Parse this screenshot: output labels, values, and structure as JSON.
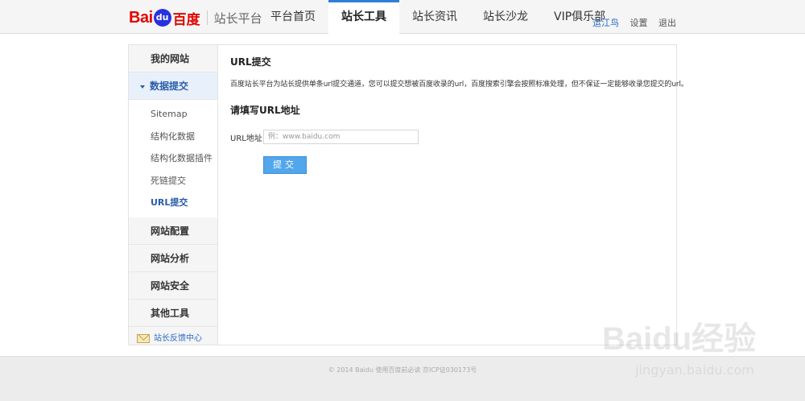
{
  "header": {
    "logo_text_bai": "Bai",
    "logo_text_du": "du",
    "logo_text_cn": "百度",
    "logo_subtitle": "站长平台",
    "nav": [
      {
        "label": "平台首页",
        "active": false
      },
      {
        "label": "站长工具",
        "active": true
      },
      {
        "label": "站长资讯",
        "active": false
      },
      {
        "label": "站长沙龙",
        "active": false
      },
      {
        "label": "VIP俱乐部",
        "active": false
      }
    ],
    "user": {
      "name": "运江鸟",
      "settings": "设置",
      "logout": "退出"
    }
  },
  "sidebar": {
    "my_site": "我的网站",
    "data_submit": "数据提交",
    "sub_items": [
      {
        "label": "Sitemap",
        "active": false
      },
      {
        "label": "结构化数据",
        "active": false
      },
      {
        "label": "结构化数据插件",
        "active": false
      },
      {
        "label": "死链提交",
        "active": false
      },
      {
        "label": "URL提交",
        "active": true
      }
    ],
    "site_config": "网站配置",
    "site_analysis": "网站分析",
    "site_security": "网站安全",
    "other_tools": "其他工具",
    "feedback": "站长反馈中心"
  },
  "main": {
    "title": "URL提交",
    "description": "百度站长平台为站长提供单条url提交通道，您可以提交想被百度收录的url，百度搜索引擎会按照标准处理，但不保证一定能够收录您提交的url。",
    "form_title": "请填写URL地址",
    "url_label": "URL地址",
    "url_placeholder": "例：www.baidu.com",
    "url_value": "",
    "submit_label": "提交"
  },
  "footer": {
    "text": "© 2014 Baidu 使用百度前必读 京ICP证030173号"
  },
  "watermark": {
    "brand": "Baidu经验",
    "url": "jingyan.baidu.com"
  },
  "colors": {
    "accent": "#2f7fd8",
    "logo_red": "#e10602",
    "logo_blue": "#2932e1",
    "button": "#52a6ec",
    "link": "#2b6ac8"
  },
  "icons": {
    "logo_paw": "baidu-paw-icon",
    "caret": "caret-down-icon",
    "feedback": "envelope-icon"
  }
}
